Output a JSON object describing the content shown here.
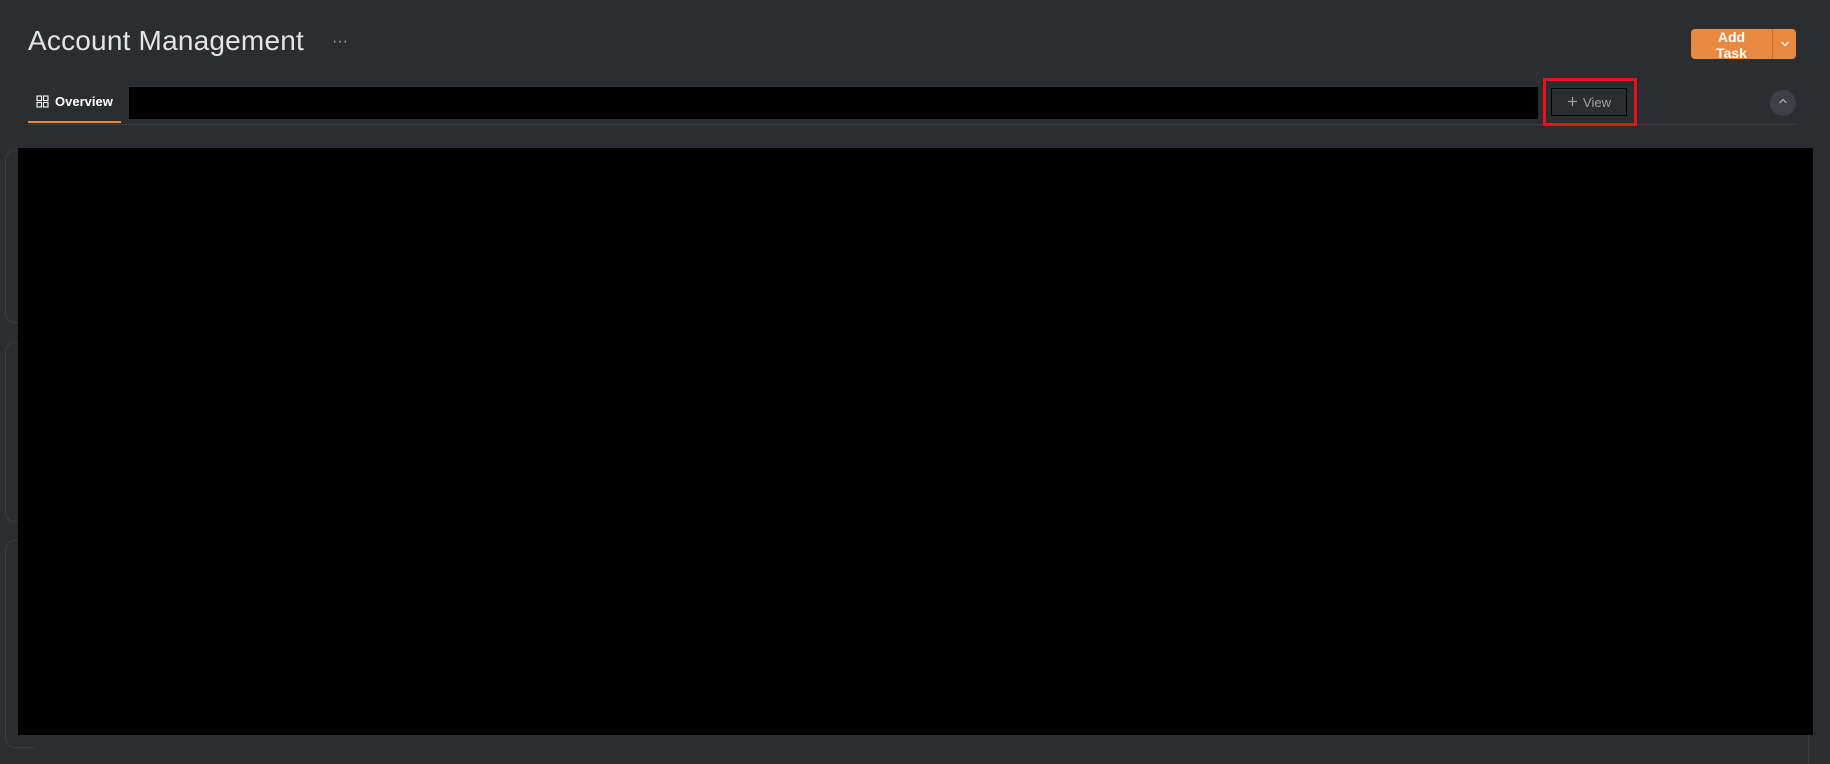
{
  "header": {
    "title": "Account Management",
    "more_label": "···",
    "add_task_label": "Add Task",
    "add_task_menu_icon": "chevron-down-icon"
  },
  "tabs": {
    "overview_label": "Overview",
    "overview_icon": "grid-icon",
    "add_view_label": "View",
    "add_view_icon": "plus-icon",
    "collapse_icon": "chevron-up-icon"
  },
  "colors": {
    "background": "#2b2d31",
    "accent": "#e8893f",
    "highlight_box": "#e8111c",
    "redacted": "#000000"
  }
}
